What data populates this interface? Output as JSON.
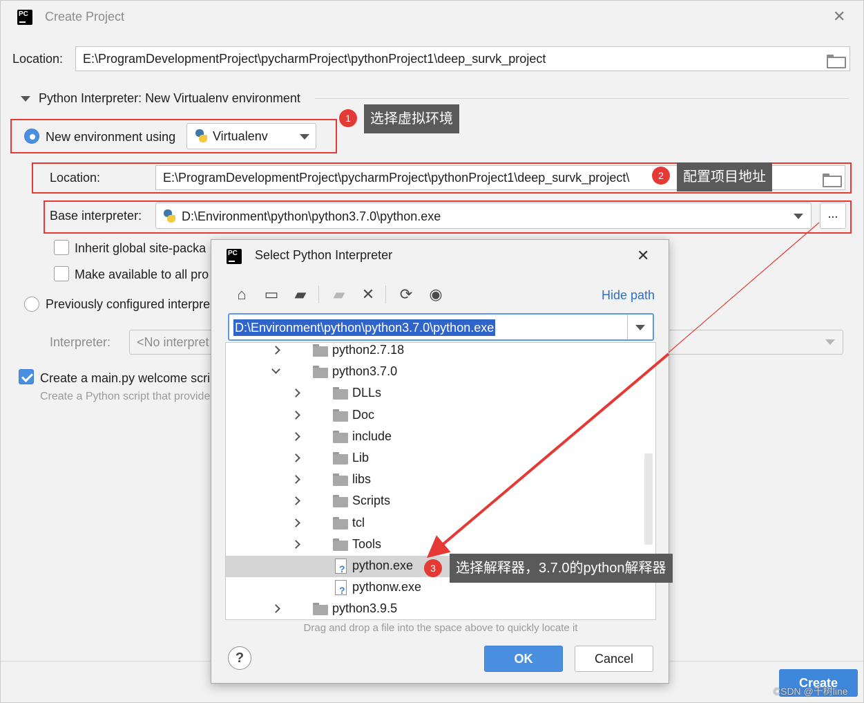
{
  "window": {
    "title": "Create Project",
    "location_label": "Location:",
    "location_value": "E:\\ProgramDevelopmentProject\\pycharmProject\\pythonProject1\\deep_survk_project",
    "interpreter_section": "Python Interpreter: New Virtualenv environment",
    "new_env_label": "New environment using",
    "env_tool": "Virtualenv",
    "venv_location_label": "Location:",
    "venv_location_value": "E:\\ProgramDevelopmentProject\\pycharmProject\\pythonProject1\\deep_survk_project\\",
    "base_interpreter_label": "Base interpreter:",
    "base_interpreter_value": "D:\\Environment\\python\\python3.7.0\\python.exe",
    "ellipsis": "...",
    "inherit_label": "Inherit global site-packa",
    "make_available_label": "Make available to all pro",
    "previously_configured_label": "Previously configured interpre",
    "interpreter_label": "Interpreter:",
    "interpreter_value": "<No interpret",
    "create_main_label": "Create a main.py welcome scri",
    "create_main_hint": "Create a Python script that provide",
    "create_button": "Create"
  },
  "annotations": {
    "step1_number": "1",
    "step1_text": "选择虚拟环境",
    "step2_number": "2",
    "step2_text": "配置项目地址",
    "step3_number": "3",
    "step3_text": "选择解释器，3.7.0的python解释器",
    "accent_color": "#e53935"
  },
  "dialog": {
    "title": "Select Python Interpreter",
    "hide_path": "Hide path",
    "path_value": "D:\\Environment\\python\\python3.7.0\\python.exe",
    "toolbar_icons": [
      "home-icon",
      "desktop-icon",
      "project-folder-icon",
      "new-folder-icon",
      "delete-icon",
      "refresh-icon",
      "show-hidden-icon"
    ],
    "tree": [
      {
        "label": "python2.7.18",
        "kind": "folder",
        "level": 1,
        "state": "collapsed"
      },
      {
        "label": "python3.7.0",
        "kind": "folder",
        "level": 1,
        "state": "expanded"
      },
      {
        "label": "DLLs",
        "kind": "folder",
        "level": 2,
        "state": "collapsed"
      },
      {
        "label": "Doc",
        "kind": "folder",
        "level": 2,
        "state": "collapsed"
      },
      {
        "label": "include",
        "kind": "folder",
        "level": 2,
        "state": "collapsed"
      },
      {
        "label": "Lib",
        "kind": "folder",
        "level": 2,
        "state": "collapsed"
      },
      {
        "label": "libs",
        "kind": "folder",
        "level": 2,
        "state": "collapsed"
      },
      {
        "label": "Scripts",
        "kind": "folder",
        "level": 2,
        "state": "collapsed"
      },
      {
        "label": "tcl",
        "kind": "folder",
        "level": 2,
        "state": "collapsed"
      },
      {
        "label": "Tools",
        "kind": "folder",
        "level": 2,
        "state": "collapsed"
      },
      {
        "label": "python.exe",
        "kind": "file",
        "level": 2,
        "selected": true
      },
      {
        "label": "pythonw.exe",
        "kind": "file",
        "level": 2
      },
      {
        "label": "python3.9.5",
        "kind": "folder",
        "level": 1,
        "state": "collapsed"
      }
    ],
    "drag_hint": "Drag and drop a file into the space above to quickly locate it",
    "help": "?",
    "ok": "OK",
    "cancel": "Cancel"
  },
  "watermark": "CSDN @千树line"
}
